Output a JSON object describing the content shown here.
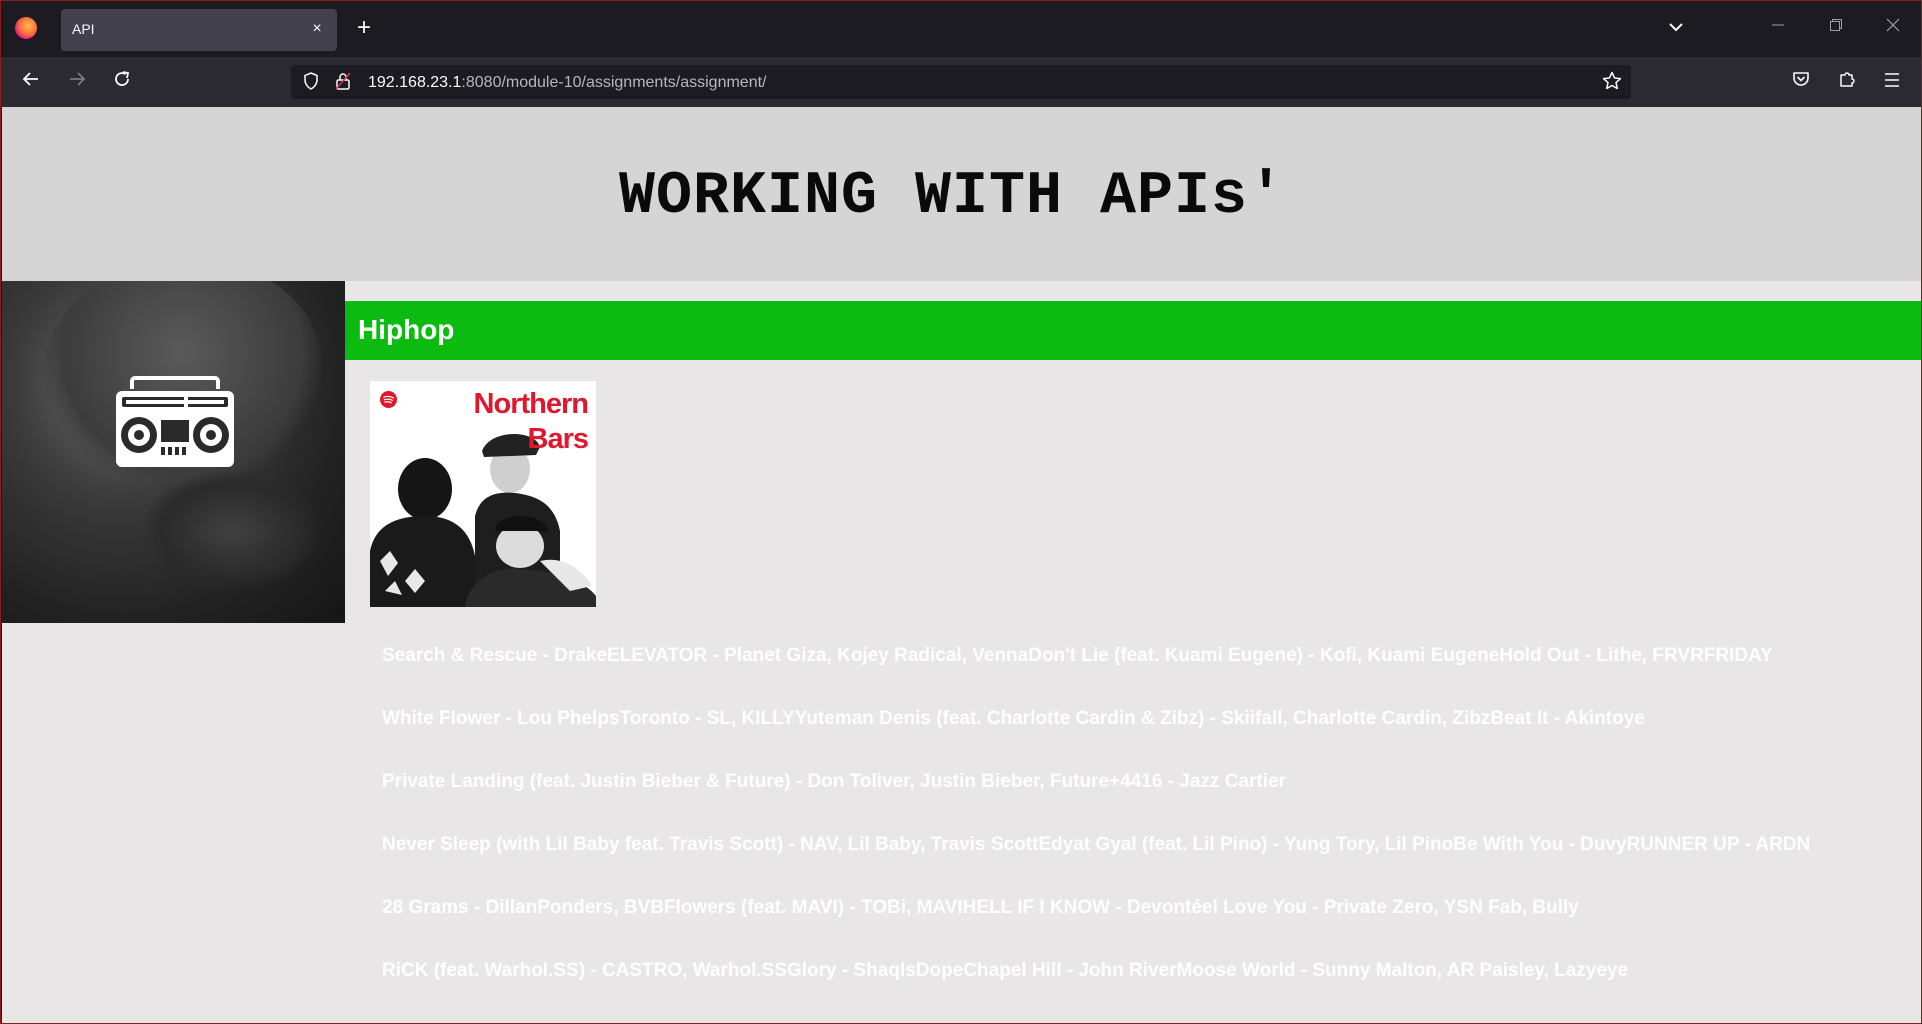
{
  "browser": {
    "tab_title": "API",
    "tab_close": "×",
    "new_tab": "+",
    "url_host": "192.168.23.1",
    "url_rest": ":8080/module-10/assignments/assignment/"
  },
  "page": {
    "heading": "WORKING WITH APIs'",
    "genre": "Hiphop",
    "cover": {
      "title_line1": "Northern",
      "title_line2": "Bars"
    },
    "tracks": [
      "Search & Rescue - DrakeELEVATOR - Planet Giza, Kojey Radical, VennaDon't Lie (feat. Kuami Eugene) - Kofi, Kuami EugeneHold Out - Lithe, FRVRFRIDAY",
      "White Flower - Lou PhelpsToronto - SL, KILLYYuteman Denis (feat. Charlotte Cardin & Zibz) - Skiifall, Charlotte Cardin, ZibzBeat It - Akintoye",
      "Private Landing (feat. Justin Bieber & Future) - Don Toliver, Justin Bieber, Future+4416 - Jazz Cartier",
      "Never Sleep (with Lil Baby feat. Travis Scott) - NAV, Lil Baby, Travis ScottEdyat Gyal (feat. Lil Pino) - Yung Tory, Lil PinoBe With You - DuvyRUNNER UP - ARDN",
      "28 Grams - DillanPonders, BVBFlowers (feat. MAVI) - TOBi, MAVIHELL IF I KNOW - Devontéel Love You - Private Zero, YSN Fab, Bully",
      "RiCK (feat. Warhol.SS) - CASTRO, Warhol.SSGlory - ShaqIsDopeChapel Hill - John RiverMoose World - Sunny Malton, AR Paisley, Lazyeye"
    ]
  },
  "colors": {
    "genre_bar": "#0bbb10",
    "header_bg": "#d5d5d5",
    "page_bg": "#e8e6e6",
    "cover_title": "#e0182d"
  },
  "icons": {
    "browser_logo": "firefox-icon",
    "back": "arrow-left-icon",
    "forward": "arrow-right-icon",
    "reload": "reload-icon",
    "tracking": "shield-icon",
    "lock": "lock-icon",
    "bookmark": "star-icon",
    "pocket": "pocket-icon",
    "extensions": "puzzle-icon",
    "menu": "hamburger-icon",
    "genre_art": "boombox-icon"
  }
}
